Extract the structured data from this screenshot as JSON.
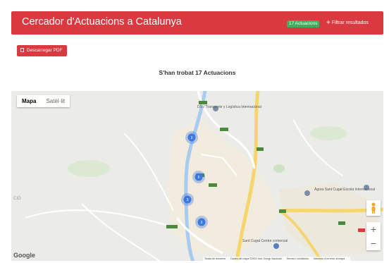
{
  "header": {
    "title": "Cercador d'Actuacions a Catalunya",
    "badge": "17 Actuacions",
    "filter_label": "Filtrar resultados"
  },
  "actions": {
    "pdf_label": "Descarregar PDF"
  },
  "results": {
    "heading": "S'han trobat 17 Actuacions"
  },
  "map": {
    "type_options": [
      "Mapa",
      "Satèl·lit"
    ],
    "selected_type": "Mapa",
    "zoom_in": "+",
    "zoom_out": "−",
    "logo": "Google",
    "clusters": [
      "3",
      "5",
      "3",
      "2"
    ],
    "labels": {
      "dsv": "DSV Transporte y Logística Internacional",
      "agora": "Àgora Sant Cugat Escola Internacional",
      "santcugat": "Sant Cugat Centre comercial",
      "cio": "CIÓ"
    },
    "attribution": [
      "Teclas de dreceres",
      "Dades del mapa ©2021 Inst. Geogr. Nacional",
      "Termes i condicions",
      "Informeu d'un error al mapa"
    ]
  },
  "colors": {
    "brand_red": "#d9393f",
    "badge_green": "#3cae5d",
    "marker_blue": "#3b79e0"
  }
}
